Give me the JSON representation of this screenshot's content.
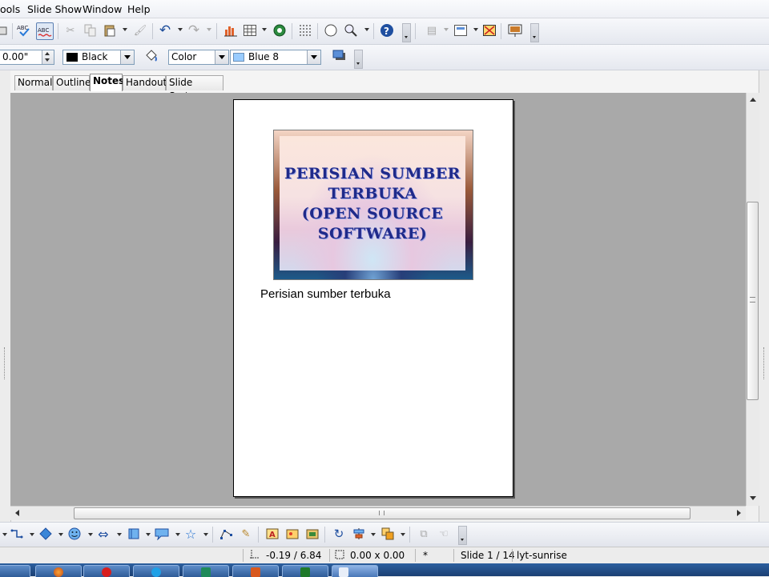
{
  "menubar": {
    "items": [
      "ools",
      "Slide Show",
      "Window",
      "Help"
    ]
  },
  "toolbar_standard": {
    "icons": [
      "load-icon",
      "spellcheck-icon",
      "autospellcheck-icon",
      "cut-icon",
      "copy-icon",
      "paste-icon",
      "format-paintbrush-icon",
      "undo-icon",
      "redo-icon",
      "chart-icon",
      "table-icon",
      "navigator-icon",
      "grid-icon",
      "navigator-compass-icon",
      "zoom-icon",
      "help-icon"
    ]
  },
  "toolbar_format": {
    "line_width": "0.00\"",
    "line_color": "Black",
    "area_style": "Color",
    "area_fill": "Blue 8",
    "line_color_swatch": "#000000",
    "area_fill_swatch": "#99ccff"
  },
  "tabs": [
    {
      "label": "Normal",
      "active": false
    },
    {
      "label": "Outline",
      "active": false
    },
    {
      "label": "Notes",
      "active": true
    },
    {
      "label": "Handout",
      "active": false
    },
    {
      "label": "Slide Sorter",
      "active": false
    }
  ],
  "slide": {
    "title_lines": [
      "PERISIAN SUMBER",
      "TERBUKA",
      "(OPEN SOURCE",
      "SOFTWARE)"
    ],
    "notes": "Perisian sumber terbuka"
  },
  "statusbar": {
    "position": "-0.19 / 6.84",
    "size": "0.00 x 0.00",
    "modified": "*",
    "slide": "Slide 1 / 14",
    "layout": "lyt-sunrise"
  }
}
